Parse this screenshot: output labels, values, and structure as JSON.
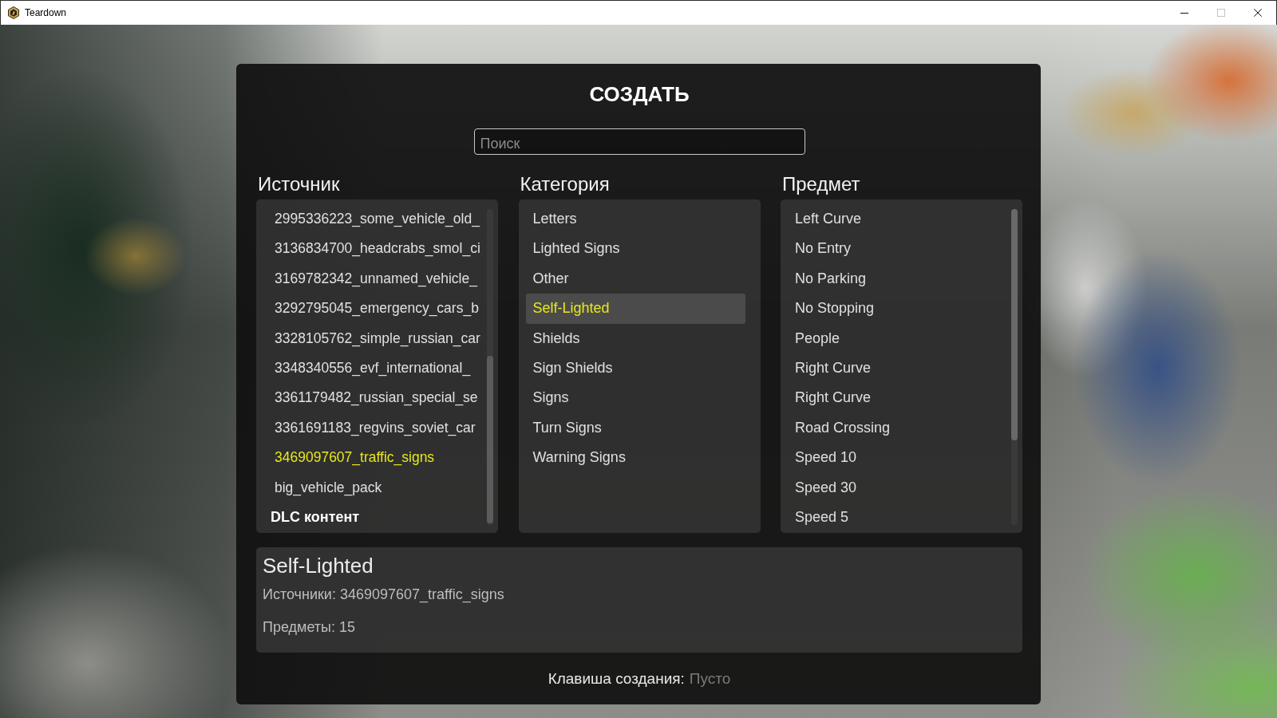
{
  "window": {
    "title": "Teardown",
    "controls": [
      {
        "kind": "minimize",
        "disabled": false
      },
      {
        "kind": "maximize",
        "disabled": true
      },
      {
        "kind": "close",
        "disabled": false
      }
    ]
  },
  "dialog": {
    "title": "СОЗДАТЬ",
    "search": {
      "placeholder": "Поиск"
    },
    "columns": [
      {
        "heading": "Источник",
        "scrollbar": true,
        "items": [
          {
            "kind": "item",
            "label": "2995336223_some_vehicle_old_",
            "selected": false,
            "hovered": false
          },
          {
            "kind": "item",
            "label": "3136834700_headcrabs_smol_ci",
            "selected": false,
            "hovered": false
          },
          {
            "kind": "item",
            "label": "3169782342_unnamed_vehicle_",
            "selected": false,
            "hovered": false
          },
          {
            "kind": "item",
            "label": "3292795045_emergency_cars_b",
            "selected": false,
            "hovered": false
          },
          {
            "kind": "item",
            "label": "3328105762_simple_russian_car",
            "selected": false,
            "hovered": false
          },
          {
            "kind": "item",
            "label": "3348340556_evf_international_",
            "selected": false,
            "hovered": false
          },
          {
            "kind": "item",
            "label": "3361179482_russian_special_se",
            "selected": false,
            "hovered": false
          },
          {
            "kind": "item",
            "label": "3361691183_regvins_soviet_car",
            "selected": false,
            "hovered": false
          },
          {
            "kind": "item",
            "label": "3469097607_traffic_signs",
            "selected": true,
            "hovered": false
          },
          {
            "kind": "item",
            "label": "big_vehicle_pack",
            "selected": false,
            "hovered": false
          },
          {
            "kind": "group",
            "label": "DLC контент",
            "selected": false,
            "hovered": false
          }
        ]
      },
      {
        "heading": "Категория",
        "scrollbar": false,
        "items": [
          {
            "kind": "item",
            "label": "Letters",
            "selected": false,
            "hovered": false
          },
          {
            "kind": "item",
            "label": "Lighted Signs",
            "selected": false,
            "hovered": false
          },
          {
            "kind": "item",
            "label": "Other",
            "selected": false,
            "hovered": false
          },
          {
            "kind": "item",
            "label": "Self-Lighted",
            "selected": true,
            "hovered": true
          },
          {
            "kind": "item",
            "label": "Shields",
            "selected": false,
            "hovered": false
          },
          {
            "kind": "item",
            "label": "Sign Shields",
            "selected": false,
            "hovered": false
          },
          {
            "kind": "item",
            "label": "Signs",
            "selected": false,
            "hovered": false
          },
          {
            "kind": "item",
            "label": "Turn Signs",
            "selected": false,
            "hovered": false
          },
          {
            "kind": "item",
            "label": "Warning Signs",
            "selected": false,
            "hovered": false
          }
        ]
      },
      {
        "heading": "Предмет",
        "scrollbar": true,
        "items": [
          {
            "kind": "item",
            "label": "Left Curve",
            "selected": false,
            "hovered": false
          },
          {
            "kind": "item",
            "label": "No Entry",
            "selected": false,
            "hovered": false
          },
          {
            "kind": "item",
            "label": "No Parking",
            "selected": false,
            "hovered": false
          },
          {
            "kind": "item",
            "label": "No Stopping",
            "selected": false,
            "hovered": false
          },
          {
            "kind": "item",
            "label": "People",
            "selected": false,
            "hovered": false
          },
          {
            "kind": "item",
            "label": "Right Curve",
            "selected": false,
            "hovered": false
          },
          {
            "kind": "item",
            "label": "Right Curve",
            "selected": false,
            "hovered": false
          },
          {
            "kind": "item",
            "label": "Road Crossing",
            "selected": false,
            "hovered": false
          },
          {
            "kind": "item",
            "label": "Speed 10",
            "selected": false,
            "hovered": false
          },
          {
            "kind": "item",
            "label": "Speed 30",
            "selected": false,
            "hovered": false
          },
          {
            "kind": "item",
            "label": "Speed 5",
            "selected": false,
            "hovered": false
          }
        ]
      }
    ],
    "details": {
      "title": "Self-Lighted",
      "lines": [
        "Источники: 3469097607_traffic_signs",
        "Предметы: 15"
      ]
    },
    "footer": {
      "label": "Клавиша создания:",
      "value": "Пусто"
    }
  }
}
